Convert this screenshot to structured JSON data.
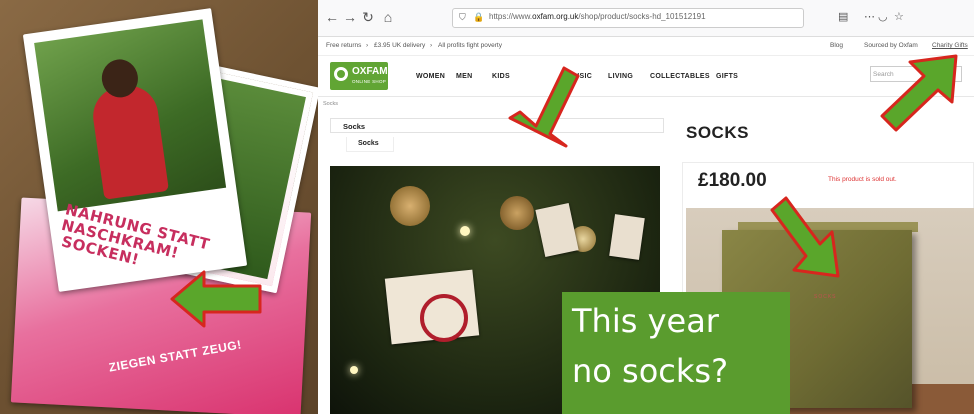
{
  "photo": {
    "card_text_1": "NAHRUNG STATT NASCHKRAM!",
    "card_text_2": "SOCKEN!",
    "card_text_3": "ZIEGEN STATT ZEUG!"
  },
  "browser": {
    "url_prefix": "https://www.",
    "url_domain": "oxfam.org.uk",
    "url_path": "/shop/product/socks-hd_101512191",
    "icons": {
      "back": "back-arrow-icon",
      "forward": "forward-arrow-icon",
      "reload": "reload-icon",
      "home": "home-icon"
    }
  },
  "promo": {
    "free_returns": "Free returns",
    "delivery": "£3.95 UK delivery",
    "profits": "All profits fight poverty",
    "blog": "Blog",
    "sourced": "Sourced by Oxfam",
    "charity_gifts": "Charity Gifts"
  },
  "header": {
    "logo_title": "OXFAM",
    "logo_sub": "ONLINE SHOP",
    "nav": [
      "WOMEN",
      "MEN",
      "KIDS",
      "MUSIC",
      "LIVING",
      "COLLECTABLES",
      "GIFTS"
    ],
    "search_placeholder": "Search"
  },
  "product": {
    "breadcrumb": "Socks",
    "select_value": "Socks",
    "tab_label": "Socks",
    "title": "SOCKS",
    "price": "£180.00",
    "sold_out": "This product is sold out.",
    "book_label": "SOCKS"
  },
  "overlay": {
    "line1": "This year",
    "line2": "no socks?"
  },
  "colors": {
    "arrow_fill": "#5aa62b",
    "arrow_stroke": "#d7261e",
    "oxfam_green": "#61a534",
    "overlay_bg": "#5a9c2e",
    "card_pink": "#c72e5e"
  }
}
